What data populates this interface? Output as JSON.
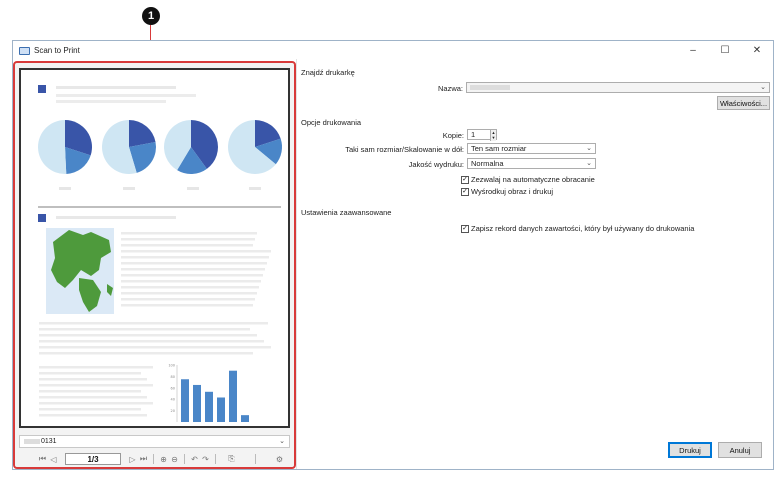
{
  "callout": {
    "number": "1"
  },
  "window": {
    "title": "Scan to Print",
    "minimize": "–",
    "maximize": "☐",
    "close": "✕"
  },
  "preview": {
    "file_name": "0131",
    "page_indicator": "1/3",
    "icons": [
      "first-page-icon",
      "prev-page-icon",
      "next-page-icon",
      "last-page-icon",
      "zoom-in-icon",
      "zoom-out-icon",
      "rotate-left-icon",
      "rotate-right-icon",
      "fit-page-icon",
      "settings-icon"
    ],
    "chart": {
      "type": "bar",
      "values": [
        75,
        65,
        53,
        43,
        90,
        12
      ],
      "ylim": [
        0,
        100
      ],
      "yticks": [
        "100",
        "80",
        "60",
        "40",
        "20"
      ],
      "color": "#4a86c8"
    },
    "pie_colors": [
      "#3955a8",
      "#4a86c8",
      "#cfe6f3"
    ]
  },
  "printer": {
    "section_title": "Znajdź drukarkę",
    "name_label": "Nazwa:",
    "properties_button": "Właściwości..."
  },
  "options": {
    "section_title": "Opcje drukowania",
    "copies_label": "Kopie:",
    "copies_value": "1",
    "scaling_label": "Taki sam rozmiar/Skalowanie w dół:",
    "scaling_value": "Ten sam rozmiar",
    "quality_label": "Jakość wydruku:",
    "quality_value": "Normalna",
    "auto_rotate_label": "Zezwalaj na automatyczne obracanie",
    "center_label": "Wyśrodkuj obraz i drukuj"
  },
  "advanced": {
    "section_title": "Ustawienia zaawansowane",
    "record_label": "Zapisz rekord danych zawartości, który był używany do drukowania"
  },
  "footer": {
    "print_button": "Drukuj",
    "cancel_button": "Anuluj"
  }
}
